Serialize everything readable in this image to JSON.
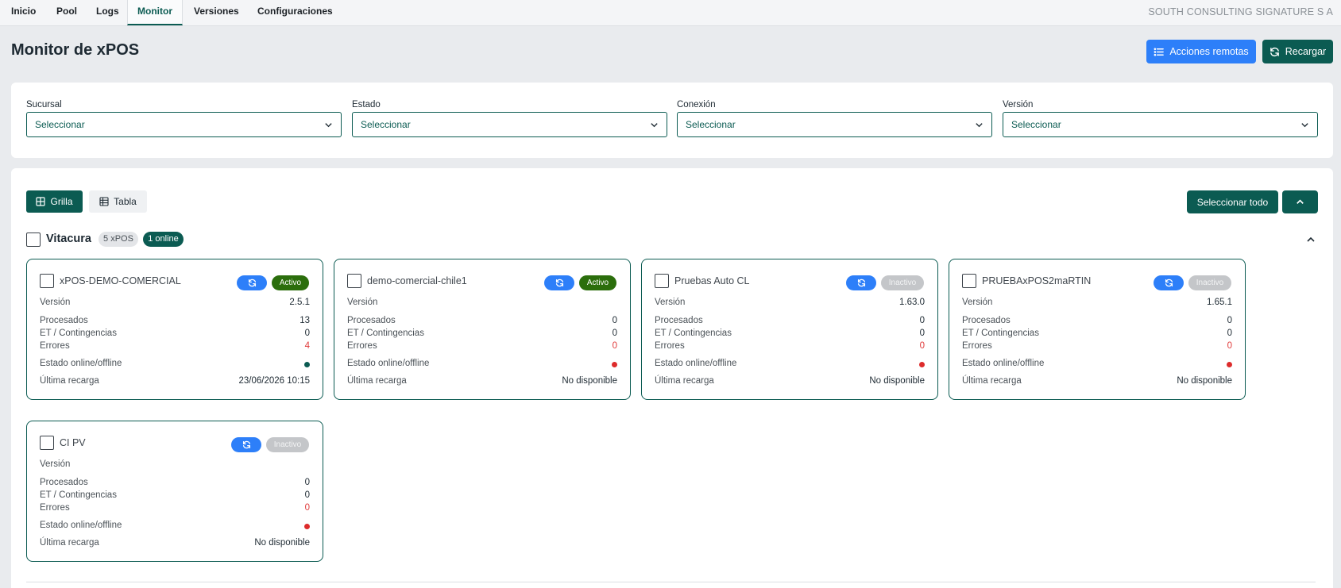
{
  "nav": {
    "tabs": [
      "Inicio",
      "Pool",
      "Logs",
      "Monitor",
      "Versiones",
      "Configuraciones"
    ],
    "active_tab": "Monitor",
    "company": "SOUTH CONSULTING SIGNATURE S A"
  },
  "header": {
    "title": "Monitor de xPOS",
    "remote_actions_label": "Acciones remotas",
    "reload_label": "Recargar"
  },
  "filters": [
    {
      "label": "Sucursal",
      "value": "Seleccionar"
    },
    {
      "label": "Estado",
      "value": "Seleccionar"
    },
    {
      "label": "Conexión",
      "value": "Seleccionar"
    },
    {
      "label": "Versión",
      "value": "Seleccionar"
    }
  ],
  "view": {
    "grid_label": "Grilla",
    "table_label": "Tabla",
    "active": "Grilla",
    "select_all_label": "Seleccionar todo"
  },
  "group": {
    "name": "Vitacura",
    "count_badge": "5 xPOS",
    "online_badge": "1 online"
  },
  "labels": {
    "version": "Versión",
    "processed": "Procesados",
    "contingencies": "ET / Contingencias",
    "errors": "Errores",
    "online_state": "Estado online/offline",
    "last_reload": "Última recarga"
  },
  "colors": {
    "brand": "#0b5b52",
    "accent_blue": "#2d7ff9",
    "active_badge": "#2b6e0c",
    "inactive_badge": "#c4c6c9",
    "error": "#e03b3b"
  },
  "devices": [
    {
      "name": "xPOS-DEMO-COMERCIAL",
      "status": "Activo",
      "version": "2.5.1",
      "processed": "13",
      "contingencies": "0",
      "errors": "4",
      "online": true,
      "last_reload": "23/06/2026 10:15"
    },
    {
      "name": "demo-comercial-chile1",
      "status": "Activo",
      "version": "",
      "processed": "0",
      "contingencies": "0",
      "errors": "0",
      "online": false,
      "last_reload": "No disponible"
    },
    {
      "name": "Pruebas Auto CL",
      "status": "Inactivo",
      "version": "1.63.0",
      "processed": "0",
      "contingencies": "0",
      "errors": "0",
      "online": false,
      "last_reload": "No disponible"
    },
    {
      "name": "PRUEBAxPOS2maRTIN",
      "status": "Inactivo",
      "version": "1.65.1",
      "processed": "0",
      "contingencies": "0",
      "errors": "0",
      "online": false,
      "last_reload": "No disponible"
    },
    {
      "name": "CI PV",
      "status": "Inactivo",
      "version": "",
      "processed": "0",
      "contingencies": "0",
      "errors": "0",
      "online": false,
      "last_reload": "No disponible"
    }
  ]
}
